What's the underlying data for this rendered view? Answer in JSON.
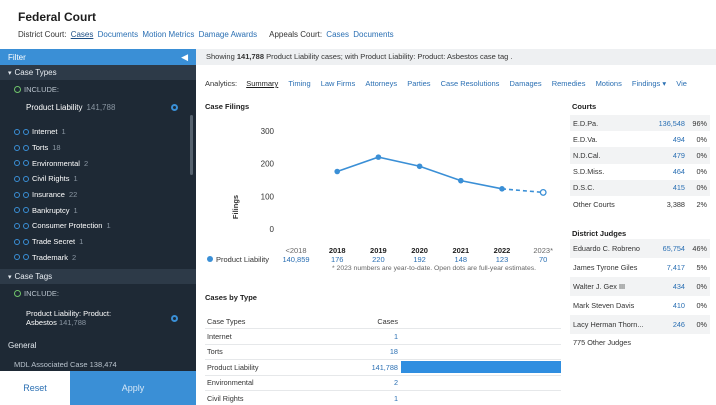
{
  "header": {
    "title": "Federal Court",
    "district_label": "District Court:",
    "district_links": [
      "Cases",
      "Documents",
      "Motion Metrics",
      "Damage Awards"
    ],
    "appeals_label": "Appeals Court:",
    "appeals_links": [
      "Cases",
      "Documents"
    ]
  },
  "sidebar": {
    "filter_label": "Filter",
    "case_types": {
      "label": "Case Types",
      "include_label": "INCLUDE:",
      "selected": {
        "label": "Product Liability",
        "count": "141,788"
      },
      "items": [
        {
          "label": "Internet",
          "count": "1"
        },
        {
          "label": "Torts",
          "count": "18"
        },
        {
          "label": "Environmental",
          "count": "2"
        },
        {
          "label": "Civil Rights",
          "count": "1"
        },
        {
          "label": "Insurance",
          "count": "22"
        },
        {
          "label": "Bankruptcy",
          "count": "1"
        },
        {
          "label": "Consumer Protection",
          "count": "1"
        },
        {
          "label": "Trade Secret",
          "count": "1"
        },
        {
          "label": "Trademark",
          "count": "2"
        }
      ]
    },
    "case_tags": {
      "label": "Case Tags",
      "include_label": "INCLUDE:",
      "selected_line1": "Product Liability: Product:",
      "selected_line2": "Asbestos",
      "selected_count": "141,788"
    },
    "general_label": "General",
    "mdl_label": "MDL Associated Case",
    "mdl_count": "138,474",
    "reset_label": "Reset",
    "apply_label": "Apply"
  },
  "main": {
    "showing_prefix": "Showing",
    "showing_count": "141,788",
    "showing_middle": "Product Liability cases;",
    "showing_suffix": "with Product Liability: Product: Asbestos case tag .",
    "analytics_label": "Analytics:",
    "tabs": [
      "Summary",
      "Timing",
      "Law Firms",
      "Attorneys",
      "Parties",
      "Case Resolutions",
      "Damages",
      "Remedies",
      "Motions",
      "Findings ▾",
      "Vie"
    ],
    "case_filings_title": "Case Filings",
    "chart_note": "* 2023 numbers are year-to-date. Open dots are full-year estimates.",
    "cases_by_type_title": "Cases by Type",
    "cases_by_type_headers": [
      "Case Types",
      "Cases"
    ],
    "cases_by_type": [
      {
        "type": "Internet",
        "cases": "1",
        "value": 1
      },
      {
        "type": "Torts",
        "cases": "18",
        "value": 18
      },
      {
        "type": "Product Liability",
        "cases": "141,788",
        "value": 141788
      },
      {
        "type": "Environmental",
        "cases": "2",
        "value": 2
      },
      {
        "type": "Civil Rights",
        "cases": "1",
        "value": 1
      }
    ],
    "courts_title": "Courts",
    "courts": [
      {
        "name": "E.D.Pa.",
        "count": "136,548",
        "pct": "96%"
      },
      {
        "name": "E.D.Va.",
        "count": "494",
        "pct": "0%"
      },
      {
        "name": "N.D.Cal.",
        "count": "479",
        "pct": "0%"
      },
      {
        "name": "S.D.Miss.",
        "count": "464",
        "pct": "0%"
      },
      {
        "name": "D.S.C.",
        "count": "415",
        "pct": "0%"
      },
      {
        "name": "Other Courts",
        "count": "3,388",
        "pct": "2%"
      }
    ],
    "judges_title": "District Judges",
    "judges": [
      {
        "name": "Eduardo C. Robreno",
        "count": "65,754",
        "pct": "46%"
      },
      {
        "name": "James Tyrone Giles",
        "count": "7,417",
        "pct": "5%"
      },
      {
        "name": "Walter J. Gex III",
        "count": "434",
        "pct": "0%"
      },
      {
        "name": "Mark Steven Davis",
        "count": "410",
        "pct": "0%"
      },
      {
        "name": "Lacy Herman Thorn...",
        "count": "246",
        "pct": "0%"
      }
    ],
    "judges_footer": "775 Other Judges"
  },
  "chart_data": {
    "type": "line",
    "title": "Case Filings",
    "ylabel": "Filings",
    "xlabel": "",
    "categories": [
      "<2018",
      "2018",
      "2019",
      "2020",
      "2021",
      "2022",
      "2023*"
    ],
    "ylim": [
      0,
      300
    ],
    "yticks": [
      0,
      100,
      200,
      300
    ],
    "series": [
      {
        "name": "Product Liability",
        "total": "140,859",
        "labels": [
          "140,859",
          "176",
          "220",
          "192",
          "148",
          "123",
          "70"
        ],
        "values": [
          null,
          176,
          220,
          192,
          148,
          123,
          112
        ]
      }
    ],
    "estimate_from_index": 5,
    "line_color": "#3a8fd6",
    "grid": false,
    "legend": "bottom-left"
  }
}
